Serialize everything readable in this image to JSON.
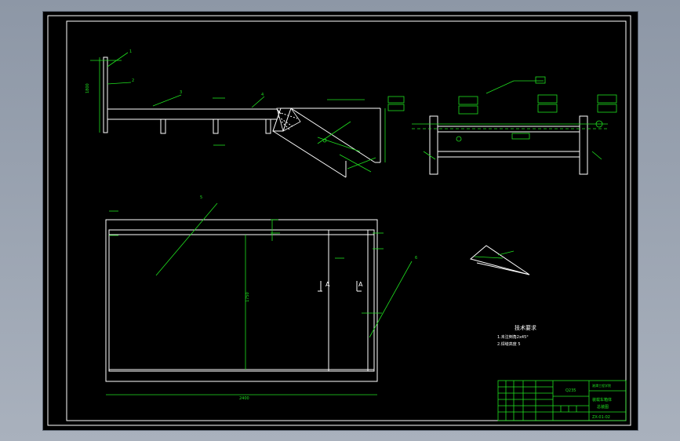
{
  "drawing": {
    "technical_requirements": {
      "title": "技术要求",
      "line1": "1.未注倒角2x45°",
      "line2": "2.焊缝高度 5"
    },
    "title_block": {
      "material": "Q235",
      "name_line1": "装载车箱体",
      "name_line2": "总装图",
      "drawing_no": "ZX-01-02",
      "company": "湘潭工程学院"
    },
    "part_numbers": [
      "1",
      "2",
      "3",
      "4",
      "5",
      "6"
    ]
  }
}
